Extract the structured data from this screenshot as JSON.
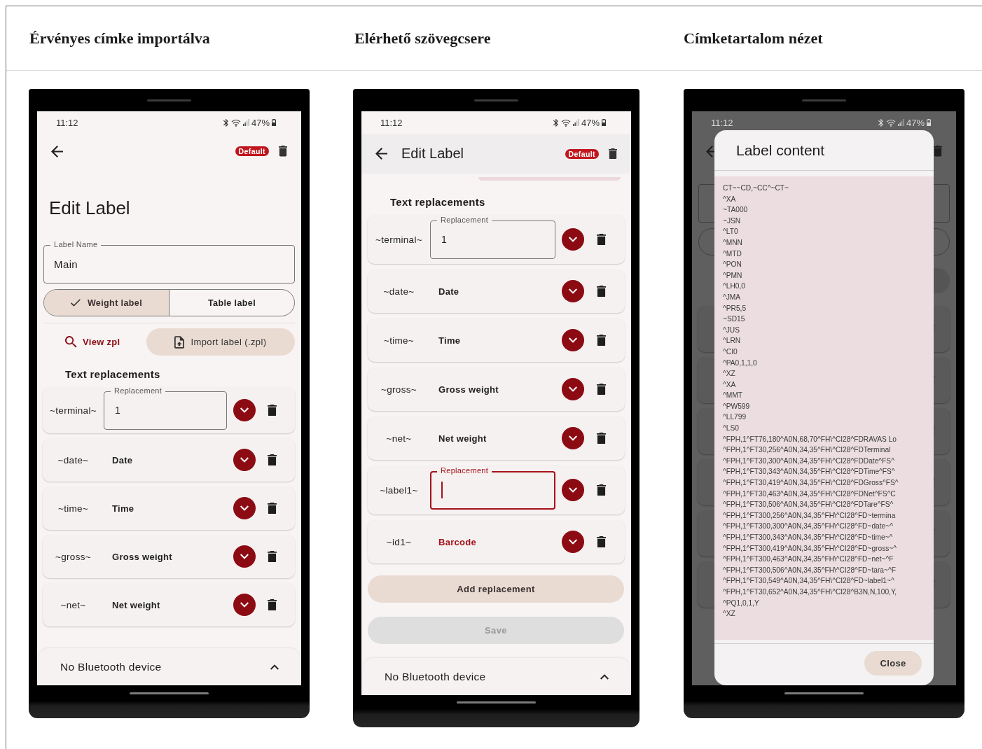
{
  "screens": [
    {
      "heading": "Érvényes címke importálva",
      "kind": "edit_label",
      "status_bar": {
        "time": "11:12",
        "battery": "47%"
      },
      "badge": "Default",
      "title": "Edit Label",
      "label_name_field": {
        "label": "Label Name",
        "value": "Main"
      },
      "label_type_toggle": [
        {
          "label": "Weight label",
          "selected": true
        },
        {
          "label": "Table label",
          "selected": false
        }
      ],
      "view_zpl_button": "View zpl",
      "import_button": "Import label (.zpl)",
      "section_title": "Text replacements",
      "replacements": [
        {
          "key": "~terminal~",
          "kind": "field",
          "field_label": "Replacement",
          "value": "1",
          "focused": false
        },
        {
          "key": "~date~",
          "kind": "choice",
          "value": "Date",
          "highlighted": false
        },
        {
          "key": "~time~",
          "kind": "choice",
          "value": "Time",
          "highlighted": false
        },
        {
          "key": "~gross~",
          "kind": "choice",
          "value": "Gross weight",
          "highlighted": false
        },
        {
          "key": "~net~",
          "kind": "choice",
          "value": "Net weight",
          "highlighted": false
        }
      ],
      "bluetooth_sheet": {
        "text": "No Bluetooth device"
      }
    },
    {
      "heading": "Elérhető szövegcsere",
      "kind": "edit_label_scrolled",
      "status_bar": {
        "time": "11:12",
        "battery": "47%"
      },
      "badge": "Default",
      "title": "Edit Label",
      "section_title": "Text replacements",
      "replacements": [
        {
          "key": "~terminal~",
          "kind": "field",
          "field_label": "Replacement",
          "value": "1",
          "focused": false
        },
        {
          "key": "~date~",
          "kind": "choice",
          "value": "Date",
          "highlighted": false
        },
        {
          "key": "~time~",
          "kind": "choice",
          "value": "Time",
          "highlighted": false
        },
        {
          "key": "~gross~",
          "kind": "choice",
          "value": "Gross weight",
          "highlighted": false
        },
        {
          "key": "~net~",
          "kind": "choice",
          "value": "Net weight",
          "highlighted": false
        },
        {
          "key": "~label1~",
          "kind": "field",
          "field_label": "Replacement",
          "focused": true
        },
        {
          "key": "~id1~",
          "kind": "choice",
          "value": "Barcode",
          "highlighted": true
        }
      ],
      "add_button": "Add replacement",
      "save_button": {
        "label": "Save",
        "disabled": true
      },
      "bluetooth_sheet": {
        "text": "No Bluetooth device"
      }
    },
    {
      "heading": "Címketartalom nézet",
      "kind": "label_content_dialog",
      "status_bar": {
        "time": "11:12",
        "battery": "47%"
      },
      "dialog": {
        "title": "Label content",
        "close_button": "Close",
        "lines": [
          "CT~~CD,~CC^~CT~",
          "^XA",
          "~TA000",
          "~JSN",
          "^LT0",
          "^MNN",
          "^MTD",
          "^PON",
          "^PMN",
          "^LH0,0",
          "^JMA",
          "^PR5,5",
          "~SD15",
          "^JUS",
          "^LRN",
          "^CI0",
          "^PA0,1,1,0",
          "^XZ",
          "^XA",
          "^MMT",
          "^PW599",
          "^LL799",
          "^LS0",
          "^FPH,1^FT76,180^A0N,68,70^FH\\^CI28^FDRAVAS Lo",
          "^FPH,1^FT30,256^A0N,34,35^FH\\^CI28^FDTerminal",
          "^FPH,1^FT30,300^A0N,34,35^FH\\^CI28^FDDate^FS^",
          "^FPH,1^FT30,343^A0N,34,35^FH\\^CI28^FDTime^FS^",
          "^FPH,1^FT30,419^A0N,34,35^FH\\^CI28^FDGross^FS^",
          "^FPH,1^FT30,463^A0N,34,35^FH\\^CI28^FDNet^FS^C",
          "^FPH,1^FT30,506^A0N,34,35^FH\\^CI28^FDTare^FS^",
          "^FPH,1^FT300,256^A0N,34,35^FH\\^CI28^FD~termina",
          "^FPH,1^FT300,300^A0N,34,35^FH\\^CI28^FD~date~^",
          "^FPH,1^FT300,343^A0N,34,35^FH\\^CI28^FD~time~^",
          "^FPH,1^FT300,419^A0N,34,35^FH\\^CI28^FD~gross~^",
          "^FPH,1^FT300,463^A0N,34,35^FH\\^CI28^FD~net~^F",
          "^FPH,1^FT300,506^A0N,34,35^FH\\^CI28^FD~tara~^F",
          "^FPH,1^FT30,549^A0N,34,35^FH\\^CI28^FD~label1~^",
          "^FPH,1^FT30,652^A0N,34,35^FH\\^CI28^B3N,N,100,Y,",
          "^PQ1,0,1,Y",
          "^XZ"
        ]
      }
    }
  ]
}
